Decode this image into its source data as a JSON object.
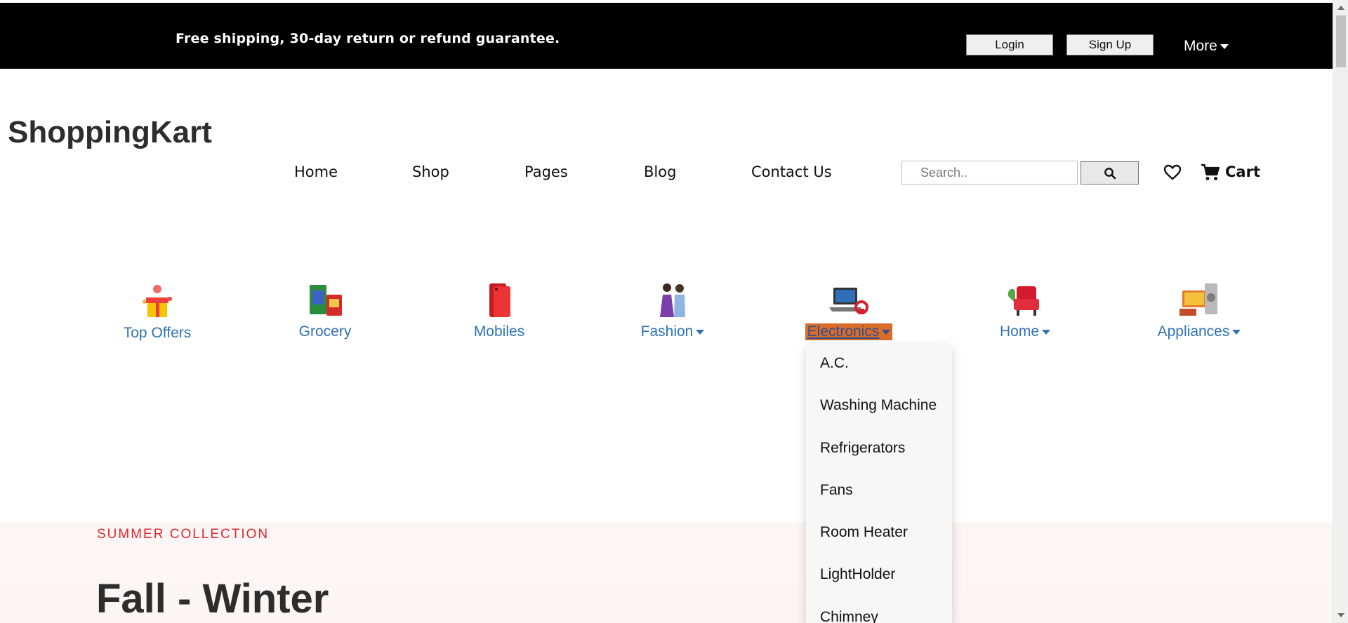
{
  "topbar": {
    "promo": "Free shipping, 30-day return or refund guarantee.",
    "login": "Login",
    "signup": "Sign Up",
    "more": "More"
  },
  "brand": "ShoppingKart",
  "nav": [
    "Home",
    "Shop",
    "Pages",
    "Blog",
    "Contact Us"
  ],
  "search": {
    "placeholder": "Search..",
    "icon": "search-icon"
  },
  "wishlist_icon": "heart-icon",
  "cart": {
    "label": "Cart",
    "icon": "cart-icon"
  },
  "categories": [
    {
      "label": "Top Offers",
      "has_menu": false
    },
    {
      "label": "Grocery",
      "has_menu": false
    },
    {
      "label": "Mobiles",
      "has_menu": false
    },
    {
      "label": "Fashion",
      "has_menu": true
    },
    {
      "label": "Electronics",
      "has_menu": true,
      "active": true
    },
    {
      "label": "Home",
      "has_menu": true
    },
    {
      "label": "Appliances",
      "has_menu": true
    }
  ],
  "dropdown": {
    "items": [
      "A.C.",
      "Washing Machine",
      "Refrigerators",
      "Fans",
      "Room Heater",
      "LightHolder",
      "Chimney"
    ]
  },
  "hero": {
    "eyebrow": "SUMMER COLLECTION",
    "headline": "Fall - Winter"
  },
  "colors": {
    "topbar_bg": "#000000",
    "category_link": "#2f72b4",
    "active_category_bg": "#d96c2a",
    "eyebrow": "#e0272b"
  }
}
